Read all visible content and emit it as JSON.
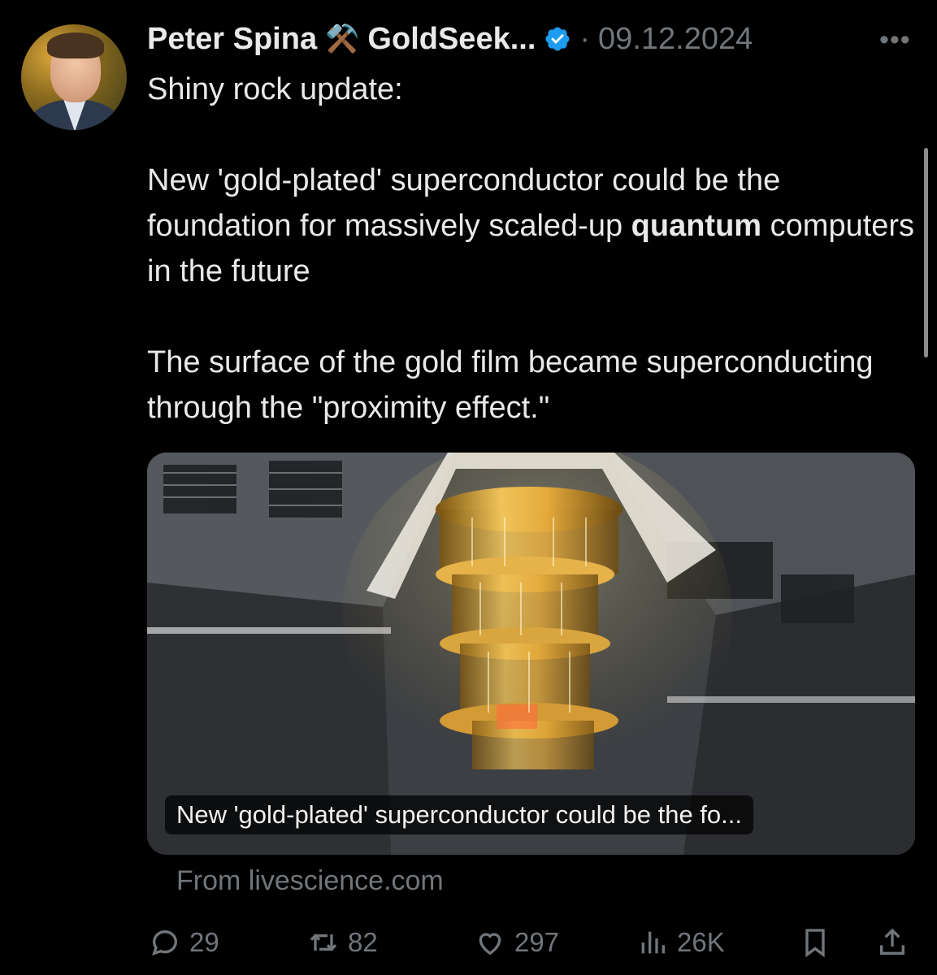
{
  "tweet": {
    "author": {
      "name": "Peter Spina",
      "emoji": "⚒️",
      "display": "GoldSeek..."
    },
    "separator": "·",
    "date": "09.12.2024",
    "more_label": "•••",
    "paragraphs": [
      "Shiny rock update:",
      "",
      "New 'gold-plated' superconductor could be the foundation for massively scaled-up",
      "quantum",
      "computers in the future",
      "",
      "The surface of the gold film became superconducting through the \"proximity effect.\""
    ],
    "card": {
      "caption": "New 'gold-plated' superconductor could be the fo...",
      "source": "From livescience.com"
    },
    "actions": {
      "replies": "29",
      "retweets": "82",
      "likes": "297",
      "views": "26K"
    }
  },
  "colors": {
    "background": "#000000",
    "text": "#e7e9ea",
    "muted": "#71767b",
    "verified": "#1d9bf0",
    "gold": "#d4a437"
  },
  "icons": [
    "reply-icon",
    "retweet-icon",
    "like-icon",
    "views-icon",
    "bookmark-icon",
    "share-icon",
    "verified-badge-icon",
    "more-icon"
  ]
}
